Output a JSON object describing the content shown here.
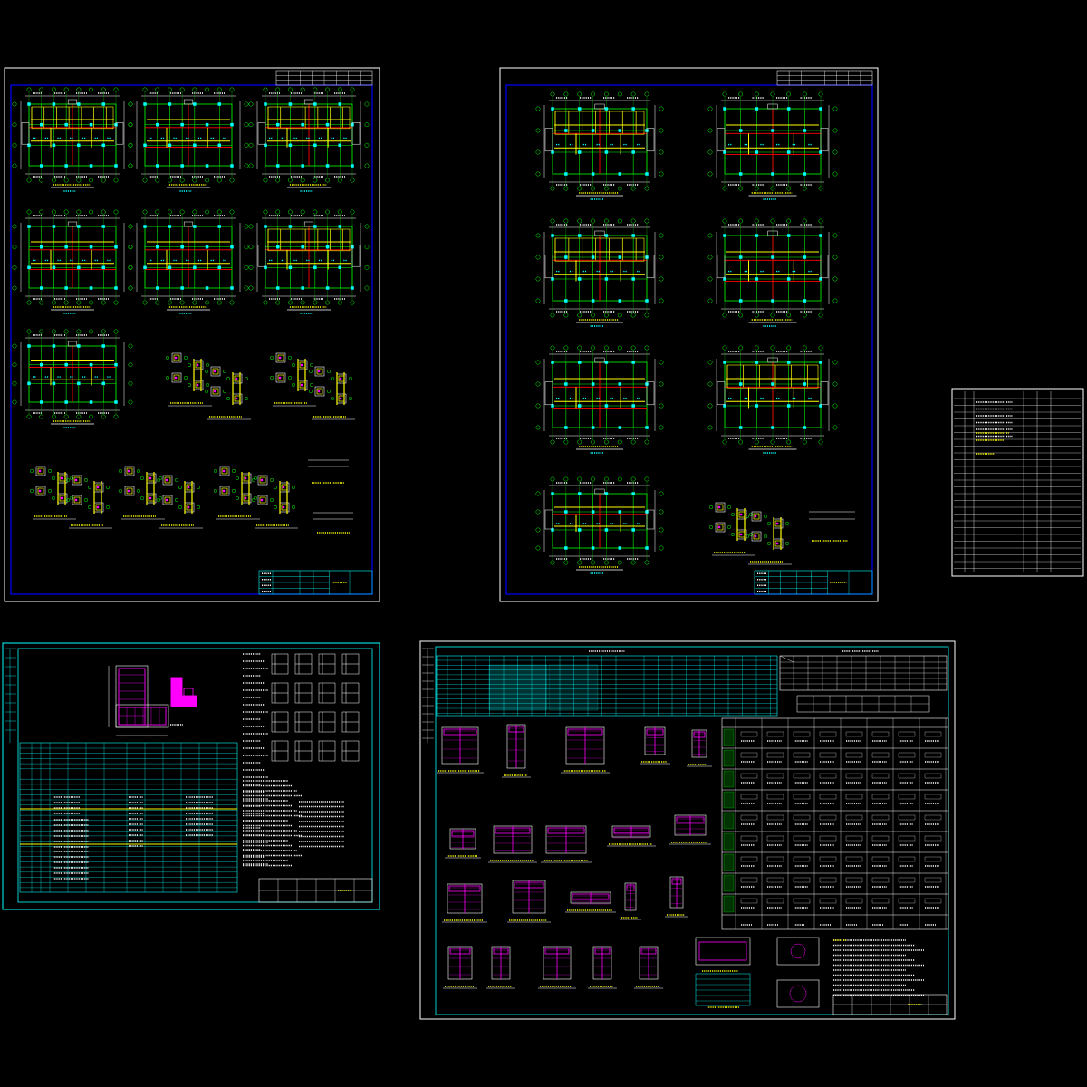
{
  "viewer": {
    "background": "#000000",
    "colors": {
      "sheet_border": "#FFFFFF",
      "inner_frame": "#0000FF",
      "cyan": "#00FFFF",
      "yellow": "#FFFF00",
      "red": "#FF0000",
      "green": "#00FF00",
      "magenta": "#FF00FF",
      "white": "#FFFFFF"
    }
  },
  "sheets": [
    {
      "name": "sheet-structural-plans-1",
      "plans": 7,
      "details": 8
    },
    {
      "name": "sheet-structural-plans-2",
      "plans": 7,
      "details": 2
    },
    {
      "name": "sheet-drawing-index"
    },
    {
      "name": "sheet-column-schedule"
    },
    {
      "name": "sheet-wall-details"
    }
  ]
}
